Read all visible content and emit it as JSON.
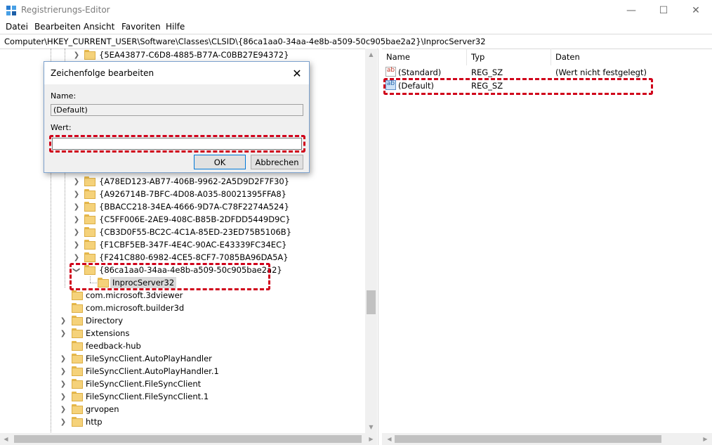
{
  "window": {
    "title": "Registrierungs-Editor",
    "minimize_glyph": "—",
    "maximize_glyph": "☐",
    "close_glyph": "✕",
    "app_icon": "regedit-icon"
  },
  "menu": [
    "Datei",
    "Bearbeiten",
    "Ansicht",
    "Favoriten",
    "Hilfe"
  ],
  "address": "Computer\\HKEY_CURRENT_USER\\Software\\Classes\\CLSID\\{86ca1aa0-34aa-4e8b-a509-50c905bae2a2}\\InprocServer32",
  "tree": {
    "top_items": [
      "{5EA43877-C6D8-4885-B77A-C0BB27E94372}"
    ],
    "clsid_items": [
      "{A78ED123-AB77-406B-9962-2A5D9D2F7F30}",
      "{A926714B-7BFC-4D08-A035-80021395FFA8}",
      "{BBACC218-34EA-4666-9D7A-C78F2274A524}",
      "{C5FF006E-2AE9-408C-B85B-2DFDD5449D9C}",
      "{CB3D0F55-BC2C-4C1A-85ED-23ED75B5106B}",
      "{F1CBF5EB-347F-4E4C-90AC-E43339FC34EC}",
      "{F241C880-6982-4CE5-8CF7-7085BA96DA5A}"
    ],
    "expanded_item": "{86ca1aa0-34aa-4e8b-a509-50c905bae2a2}",
    "selected_child": "InprocServer32",
    "class_items": [
      "com.microsoft.3dviewer",
      "com.microsoft.builder3d",
      "Directory",
      "Extensions",
      "feedback-hub",
      "FileSyncClient.AutoPlayHandler",
      "FileSyncClient.AutoPlayHandler.1",
      "FileSyncClient.FileSyncClient",
      "FileSyncClient.FileSyncClient.1",
      "grvopen",
      "http"
    ]
  },
  "values": {
    "columns": [
      "Name",
      "Typ",
      "Daten"
    ],
    "rows": [
      {
        "name": "(Standard)",
        "type": "REG_SZ",
        "data": "(Wert nicht festgelegt)"
      },
      {
        "name": "(Default)",
        "type": "REG_SZ",
        "data": ""
      }
    ]
  },
  "dialog": {
    "title": "Zeichenfolge bearbeiten",
    "name_label": "Name:",
    "name_value": "(Default)",
    "value_label": "Wert:",
    "value_value": "",
    "ok_label": "OK",
    "cancel_label": "Abbrechen"
  },
  "colors": {
    "highlight_dash": "#d0021b",
    "selection": "#cce8ff",
    "folder": "#f5d27a"
  }
}
